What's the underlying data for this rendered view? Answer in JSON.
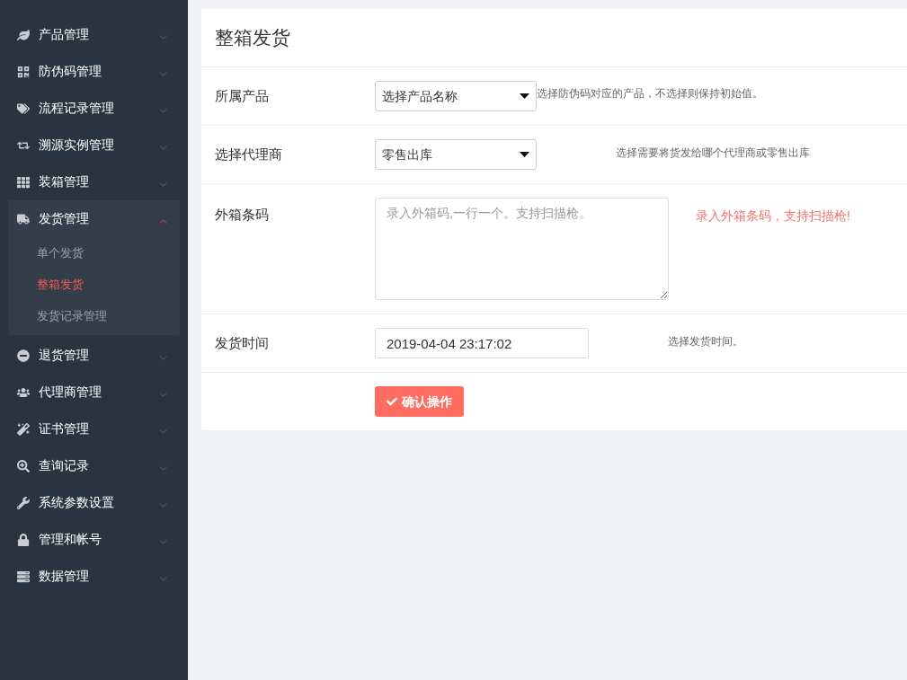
{
  "sidebar": {
    "items": [
      {
        "label": "产品管理",
        "expanded": false
      },
      {
        "label": "防伪码管理",
        "expanded": false
      },
      {
        "label": "流程记录管理",
        "expanded": false
      },
      {
        "label": "溯源实例管理",
        "expanded": false
      },
      {
        "label": "装箱管理",
        "expanded": false
      },
      {
        "label": "发货管理",
        "expanded": true,
        "children": [
          {
            "label": "单个发货",
            "selected": false
          },
          {
            "label": "整箱发货",
            "selected": true
          },
          {
            "label": "发货记录管理",
            "selected": false
          }
        ]
      },
      {
        "label": "退货管理",
        "expanded": false
      },
      {
        "label": "代理商管理",
        "expanded": false
      },
      {
        "label": "证书管理",
        "expanded": false
      },
      {
        "label": "查询记录",
        "expanded": false
      },
      {
        "label": "系统参数设置",
        "expanded": false
      },
      {
        "label": "管理和帐号",
        "expanded": false
      },
      {
        "label": "数据管理",
        "expanded": false
      }
    ]
  },
  "form": {
    "title": "整箱发货",
    "rows": [
      {
        "kind": "select",
        "label": "所属产品",
        "value": "选择产品名称",
        "hint": {
          "kind": "tight",
          "text": "选择防伪码对应的产品，不选择则保持初始值。"
        }
      },
      {
        "kind": "select",
        "label": "选择代理商",
        "value": "零售出库",
        "hint": {
          "kind": "normal",
          "text": "选择需要将货发给哪个代理商或零售出库"
        }
      },
      {
        "kind": "textarea",
        "label": "外箱条码",
        "placeholder": "录入外箱码,一行一个。支持扫描枪。",
        "hint": {
          "kind": "warning",
          "text": "录入外箱条码，支持扫描枪!"
        }
      },
      {
        "kind": "input",
        "label": "发货时间",
        "value": "2019-04-04 23:17:02",
        "hint": {
          "kind": "normal",
          "text": "选择发货时间。"
        }
      }
    ],
    "submit": "确认操作"
  }
}
